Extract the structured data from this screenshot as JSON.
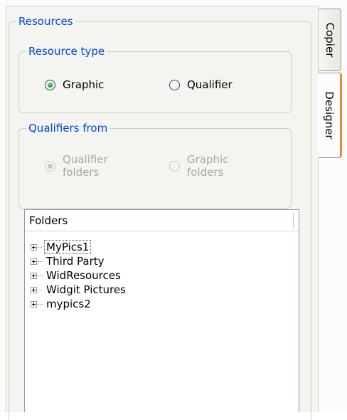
{
  "resources": {
    "title": "Resources",
    "resource_type": {
      "title": "Resource type",
      "options": [
        {
          "label": "Graphic",
          "checked": true
        },
        {
          "label": "Qualifier",
          "checked": false
        }
      ]
    },
    "qualifiers_from": {
      "title": "Qualifiers from",
      "enabled": false,
      "options": [
        {
          "label_line1": "Qualifier",
          "label_line2": "folders",
          "checked": true
        },
        {
          "label_line1": "Graphic",
          "label_line2": "folders",
          "checked": false
        }
      ]
    },
    "folders": {
      "header": "Folders",
      "items": [
        {
          "label": "MyPics1",
          "focused": true
        },
        {
          "label": "Third Party"
        },
        {
          "label": "WidResources"
        },
        {
          "label": "Widgit Pictures"
        },
        {
          "label": "mypics2"
        }
      ]
    }
  },
  "tabs": [
    {
      "label": "Copier",
      "selected": false
    },
    {
      "label": "Designer",
      "selected": true
    }
  ],
  "colors": {
    "group_title": "#0046d5",
    "panel_bg": "#f4f4f1",
    "selected_tab_accent": "#e68b2c",
    "disabled_text": "#aca899"
  }
}
